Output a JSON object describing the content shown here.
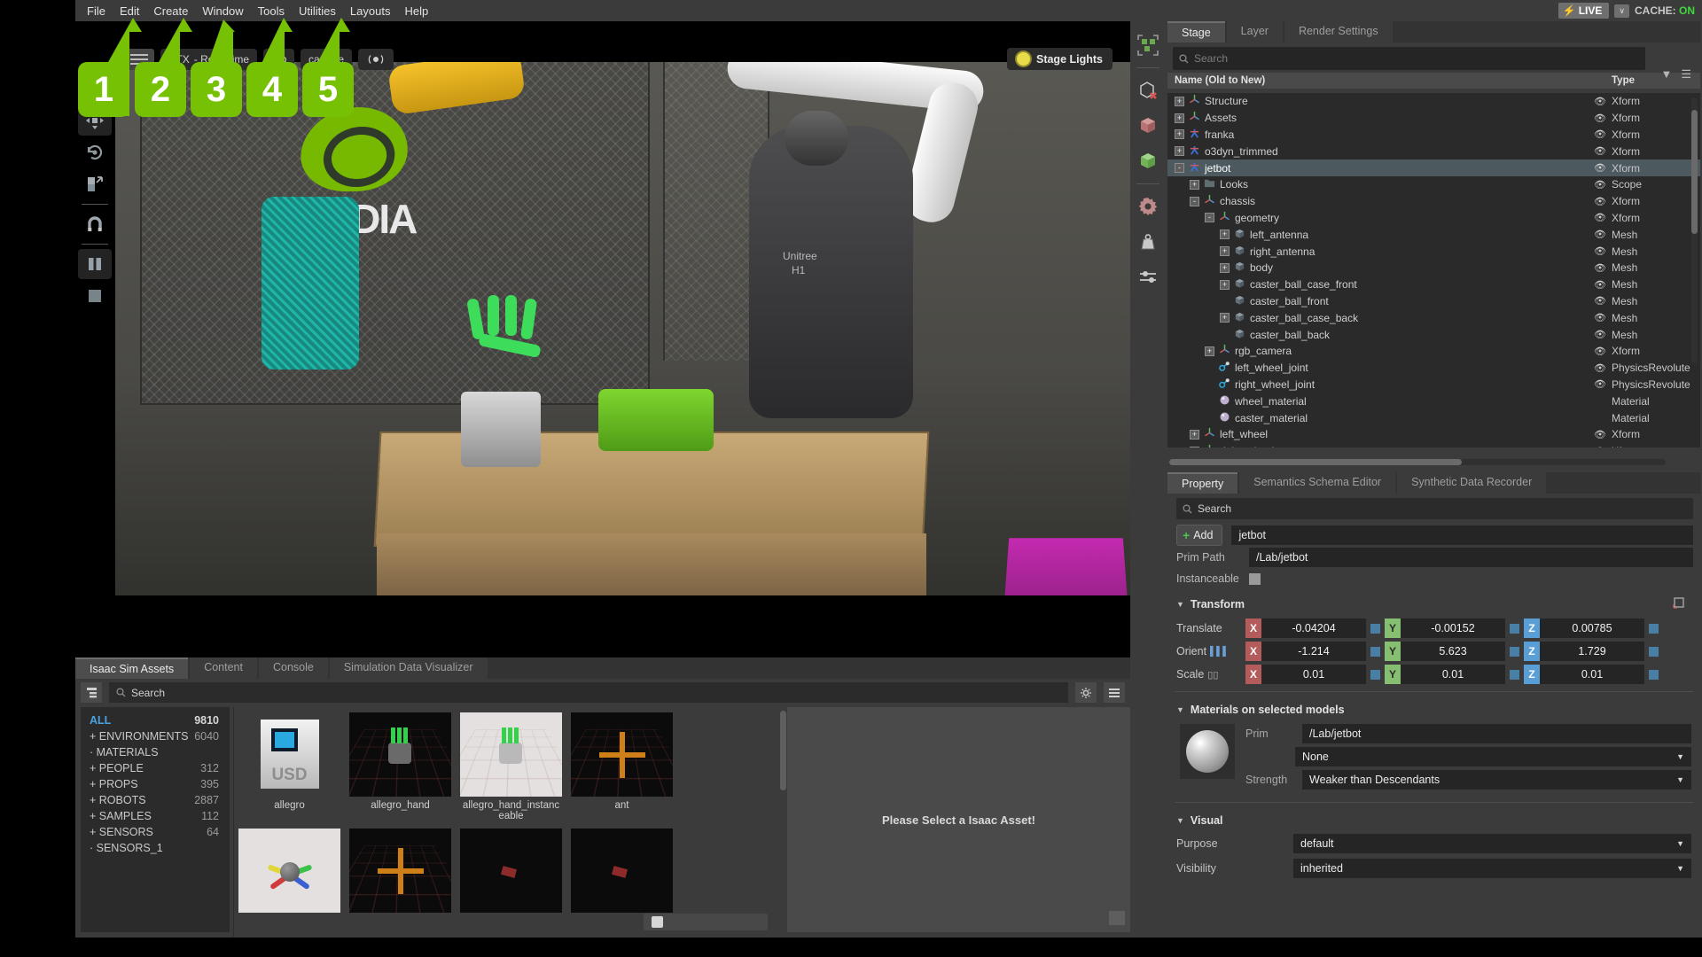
{
  "menubar": {
    "items": [
      "File",
      "Edit",
      "Create",
      "Window",
      "Tools",
      "Utilities",
      "Layouts",
      "Help"
    ],
    "live_label": "LIVE",
    "live_caret": "∨",
    "cache_label": "CACHE:",
    "cache_value": "ON",
    "cache_color": "#3fd83f"
  },
  "annotations": [
    {
      "number": "1",
      "target": "Create"
    },
    {
      "number": "2",
      "target": "Window"
    },
    {
      "number": "3",
      "target": "Tools"
    },
    {
      "number": "4",
      "target": "Utilities"
    },
    {
      "number": "5",
      "target": "Layouts"
    }
  ],
  "viewport": {
    "renderer_label": "RTX",
    "renderer_mode": "- Real-Time",
    "capture_label": "capture",
    "stage_lights_label": "Stage Lights",
    "scene_text": {
      "brand": "nVIDIA",
      "robot_brand": "Unitree",
      "robot_model": "H1"
    },
    "tools": [
      {
        "name": "move-tool",
        "active": true
      },
      {
        "name": "rotate-tool",
        "active": false
      },
      {
        "name": "scale-tool",
        "active": false
      },
      {
        "name": "snap-tool",
        "active": false
      },
      {
        "name": "pause-button",
        "active": true
      },
      {
        "name": "stop-button",
        "active": false
      }
    ]
  },
  "physics_toolbar": [
    "select-all-icon",
    "delete-cube-icon",
    "red-cube-icon",
    "green-cube-icon",
    "physics-gear-icon",
    "mass-weight-icon",
    "settings-sliders-icon"
  ],
  "stage": {
    "tabs": [
      {
        "label": "Stage",
        "active": true
      },
      {
        "label": "Layer",
        "active": false
      },
      {
        "label": "Render Settings",
        "active": false
      }
    ],
    "search_placeholder": "Search",
    "columns": {
      "name": "Name (Old to New)",
      "type": "Type"
    },
    "rows": [
      {
        "label": "Structure",
        "type": "Xform",
        "depth": 0,
        "expand": "+",
        "icon": "xform",
        "eye": true,
        "selected": false
      },
      {
        "label": "Assets",
        "type": "Xform",
        "depth": 0,
        "expand": "+",
        "icon": "xform",
        "eye": true,
        "selected": false
      },
      {
        "label": "franka",
        "type": "Xform",
        "depth": 0,
        "expand": "+",
        "icon": "robot",
        "eye": true,
        "selected": false
      },
      {
        "label": "o3dyn_trimmed",
        "type": "Xform",
        "depth": 0,
        "expand": "+",
        "icon": "robot",
        "eye": true,
        "selected": false
      },
      {
        "label": "jetbot",
        "type": "Xform",
        "depth": 0,
        "expand": "-",
        "icon": "robot",
        "eye": true,
        "selected": true
      },
      {
        "label": "Looks",
        "type": "Scope",
        "depth": 1,
        "expand": "+",
        "icon": "folder",
        "eye": true,
        "selected": false
      },
      {
        "label": "chassis",
        "type": "Xform",
        "depth": 1,
        "expand": "-",
        "icon": "xform",
        "eye": true,
        "selected": false
      },
      {
        "label": "geometry",
        "type": "Xform",
        "depth": 2,
        "expand": "-",
        "icon": "xform",
        "eye": true,
        "selected": false
      },
      {
        "label": "left_antenna",
        "type": "Mesh",
        "depth": 3,
        "expand": "+",
        "icon": "mesh",
        "eye": true,
        "selected": false
      },
      {
        "label": "right_antenna",
        "type": "Mesh",
        "depth": 3,
        "expand": "+",
        "icon": "mesh",
        "eye": true,
        "selected": false
      },
      {
        "label": "body",
        "type": "Mesh",
        "depth": 3,
        "expand": "+",
        "icon": "mesh",
        "eye": true,
        "selected": false
      },
      {
        "label": "caster_ball_case_front",
        "type": "Mesh",
        "depth": 3,
        "expand": "+",
        "icon": "mesh",
        "eye": true,
        "selected": false
      },
      {
        "label": "caster_ball_front",
        "type": "Mesh",
        "depth": 3,
        "expand": "",
        "icon": "mesh",
        "eye": true,
        "selected": false
      },
      {
        "label": "caster_ball_case_back",
        "type": "Mesh",
        "depth": 3,
        "expand": "+",
        "icon": "mesh",
        "eye": true,
        "selected": false
      },
      {
        "label": "caster_ball_back",
        "type": "Mesh",
        "depth": 3,
        "expand": "",
        "icon": "mesh",
        "eye": true,
        "selected": false
      },
      {
        "label": "rgb_camera",
        "type": "Xform",
        "depth": 2,
        "expand": "+",
        "icon": "xform",
        "eye": true,
        "selected": false
      },
      {
        "label": "left_wheel_joint",
        "type": "PhysicsRevolute",
        "depth": 2,
        "expand": "",
        "icon": "joint",
        "eye": true,
        "selected": false
      },
      {
        "label": "right_wheel_joint",
        "type": "PhysicsRevolute",
        "depth": 2,
        "expand": "",
        "icon": "joint",
        "eye": true,
        "selected": false
      },
      {
        "label": "wheel_material",
        "type": "Material",
        "depth": 2,
        "expand": "",
        "icon": "material",
        "eye": false,
        "selected": false
      },
      {
        "label": "caster_material",
        "type": "Material",
        "depth": 2,
        "expand": "",
        "icon": "material",
        "eye": false,
        "selected": false
      },
      {
        "label": "left_wheel",
        "type": "Xform",
        "depth": 1,
        "expand": "+",
        "icon": "xform",
        "eye": true,
        "selected": false
      },
      {
        "label": "right_wheel",
        "type": "Xform",
        "depth": 1,
        "expand": "+",
        "icon": "xform",
        "eye": true,
        "selected": false
      }
    ]
  },
  "property": {
    "tabs": [
      {
        "label": "Property",
        "active": true
      },
      {
        "label": "Semantics Schema Editor",
        "active": false
      },
      {
        "label": "Synthetic Data Recorder",
        "active": false
      }
    ],
    "search_placeholder": "Search",
    "add_label": "Add",
    "prim_name": "jetbot",
    "prim_path_label": "Prim Path",
    "prim_path_value": "/Lab/jetbot",
    "instanceable_label": "Instanceable",
    "transform": {
      "title": "Transform",
      "rows": [
        {
          "label": "Translate",
          "x": "-0.04204",
          "y": "-0.00152",
          "z": "0.00785"
        },
        {
          "label": "Orient",
          "x": "-1.214",
          "y": "5.623",
          "z": "1.729"
        },
        {
          "label": "Scale",
          "x": "0.01",
          "y": "0.01",
          "z": "0.01"
        }
      ],
      "axes": [
        "X",
        "Y",
        "Z"
      ]
    },
    "materials": {
      "title": "Materials on selected models",
      "prim_label": "Prim",
      "prim_value": "/Lab/jetbot",
      "material_value": "None",
      "strength_label": "Strength",
      "strength_value": "Weaker than Descendants"
    },
    "visual": {
      "title": "Visual",
      "purpose_label": "Purpose",
      "purpose_value": "default",
      "visibility_label": "Visibility",
      "visibility_value": "inherited"
    }
  },
  "assets": {
    "tabs": [
      {
        "label": "Isaac Sim Assets",
        "active": true
      },
      {
        "label": "Content",
        "active": false
      },
      {
        "label": "Console",
        "active": false
      },
      {
        "label": "Simulation Data Visualizer",
        "active": false
      }
    ],
    "search_placeholder": "Search",
    "categories": [
      {
        "label": "ALL",
        "count": "9810",
        "prefix": "",
        "highlight": true
      },
      {
        "label": "ENVIRONMENTS",
        "count": "6040",
        "prefix": "+",
        "highlight": false
      },
      {
        "label": "MATERIALS",
        "count": "",
        "prefix": "·",
        "highlight": false
      },
      {
        "label": "PEOPLE",
        "count": "312",
        "prefix": "+",
        "highlight": false
      },
      {
        "label": "PROPS",
        "count": "395",
        "prefix": "+",
        "highlight": false
      },
      {
        "label": "ROBOTS",
        "count": "2887",
        "prefix": "+",
        "highlight": false
      },
      {
        "label": "SAMPLES",
        "count": "112",
        "prefix": "+",
        "highlight": false
      },
      {
        "label": "SENSORS",
        "count": "64",
        "prefix": "+",
        "highlight": false
      },
      {
        "label": "SENSORS_1",
        "count": "",
        "prefix": "·",
        "highlight": false
      }
    ],
    "items_row1": [
      {
        "label": "allegro",
        "thumb": "usd-doc"
      },
      {
        "label": "allegro_hand",
        "thumb": "dark-hand"
      },
      {
        "label": "allegro_hand_instanceable",
        "thumb": "light-hand"
      },
      {
        "label": "ant",
        "thumb": "ant-star"
      }
    ],
    "items_row2": [
      {
        "label": "",
        "thumb": "light-axis"
      },
      {
        "label": "",
        "thumb": "ant-star2"
      },
      {
        "label": "",
        "thumb": "dark-ant"
      },
      {
        "label": "",
        "thumb": "dark-ant2"
      }
    ],
    "empty_message": "Please Select a Isaac Asset!"
  }
}
